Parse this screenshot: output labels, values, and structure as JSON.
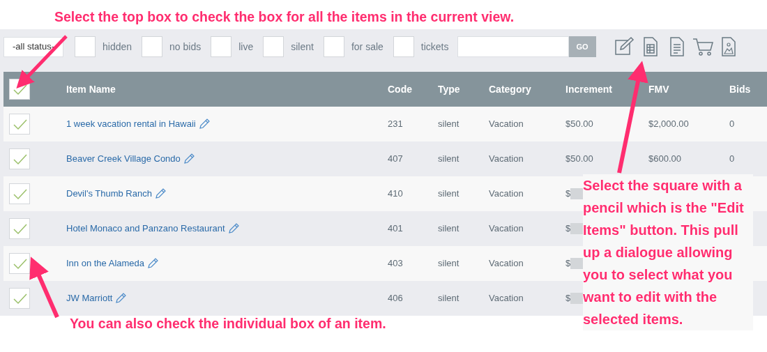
{
  "annotations": [
    {
      "kind": "top",
      "text": "Select the top box to check the box for all the items in the current view."
    },
    {
      "kind": "right",
      "text": "Select the square with a pencil which is the \"Edit Items\" button. This pull up a dialogue allowing you to select what you want to edit with the selected items."
    },
    {
      "kind": "bottom",
      "text": "You can also check the individual box of an item."
    }
  ],
  "filters": {
    "status_select": "-all status-",
    "checkboxes": [
      {
        "label": "hidden",
        "checked": false
      },
      {
        "label": "no bids",
        "checked": false
      },
      {
        "label": "live",
        "checked": false
      },
      {
        "label": "silent",
        "checked": false
      },
      {
        "label": "for sale",
        "checked": false
      },
      {
        "label": "tickets",
        "checked": false
      }
    ],
    "search_button": "GO"
  },
  "table": {
    "select_all_checked": true,
    "columns": [
      "Item Name",
      "Code",
      "Type",
      "Category",
      "Increment",
      "FMV",
      "Bids"
    ],
    "rows": [
      {
        "checked": true,
        "name": "1 week vacation rental in Hawaii",
        "code": "231",
        "type": "silent",
        "category": "Vacation",
        "increment": "$50.00",
        "fmv": "$2,000.00",
        "bids": "0",
        "redacted": false
      },
      {
        "checked": true,
        "name": "Beaver Creek Village Condo",
        "code": "407",
        "type": "silent",
        "category": "Vacation",
        "increment": "$50.00",
        "fmv": "$600.00",
        "bids": "0",
        "redacted": false
      },
      {
        "checked": true,
        "name": "Devil's Thumb Ranch",
        "code": "410",
        "type": "silent",
        "category": "Vacation",
        "increment": "$",
        "redacted": true
      },
      {
        "checked": true,
        "name": "Hotel Monaco and Panzano Restaurant",
        "code": "401",
        "type": "silent",
        "category": "Vacation",
        "increment": "$",
        "redacted": true
      },
      {
        "checked": true,
        "name": "Inn on the Alameda",
        "code": "403",
        "type": "silent",
        "category": "Vacation",
        "increment": "$",
        "redacted": true
      },
      {
        "checked": true,
        "name": "JW Marriott",
        "code": "406",
        "type": "silent",
        "category": "Vacation",
        "increment": "$",
        "redacted": true
      }
    ]
  }
}
